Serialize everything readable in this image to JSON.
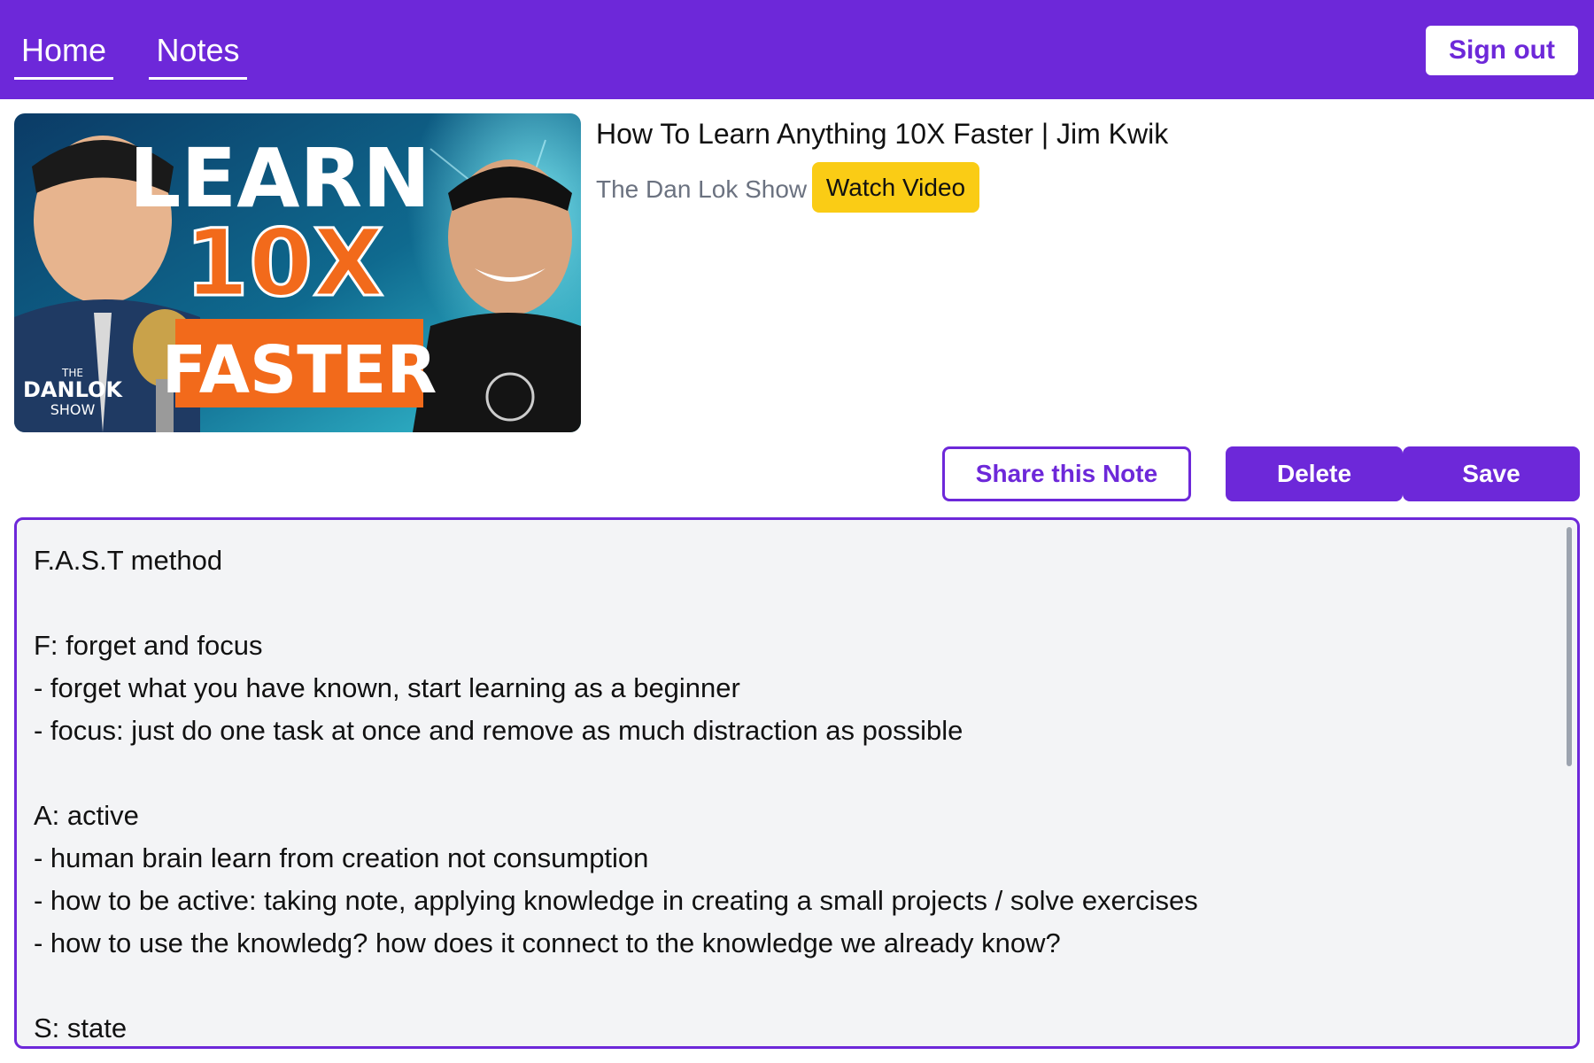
{
  "nav": {
    "home_label": "Home",
    "notes_label": "Notes",
    "signout_label": "Sign out",
    "accent_color": "#6d28d9"
  },
  "video": {
    "thumbnail": {
      "text_learn": "LEARN",
      "text_10x": "10X",
      "text_faster": "FASTER",
      "logo_the": "THE",
      "logo_danlok": "DANLOK",
      "logo_show": "SHOW"
    },
    "title": "How To Learn Anything 10X Faster | Jim Kwik",
    "channel": "The Dan Lok Show",
    "watch_label": "Watch Video",
    "watch_color": "#facc15"
  },
  "actions": {
    "share_label": "Share this Note",
    "delete_label": "Delete",
    "save_label": "Save"
  },
  "note": {
    "lines": [
      "F.A.S.T method",
      "",
      "F: forget and focus",
      "- forget what you have known, start learning as a beginner",
      "- focus: just do one task at once and remove as much distraction as possible",
      "",
      "A: active",
      "- human brain learn from creation not consumption",
      "- how to be active: taking note, applying knowledge in creating a small projects / solve exercises",
      "- how to use the knowledg? how does it connect to the knowledge we already know?",
      "",
      "S: state"
    ]
  }
}
